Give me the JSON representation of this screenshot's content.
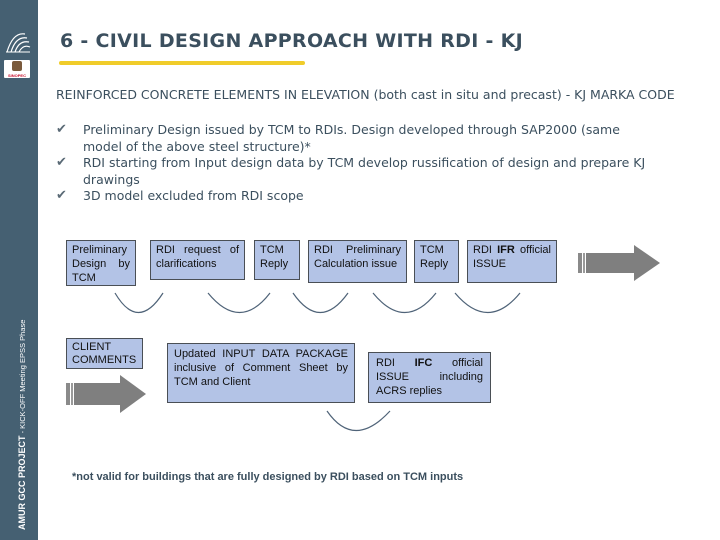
{
  "sidebar": {
    "logo_text": "SINOPEC",
    "vertical_label_main": "AMUR GCC PROJECT",
    "vertical_label_sub": " - KICK-OFF Meeting  EPSS Phase"
  },
  "slide": {
    "title": "6 - CIVIL DESIGN APPROACH WITH RDI - KJ",
    "intro": "REINFORCED CONCRETE ELEMENTS IN ELEVATION (both cast in situ and precast) - KJ MARKA CODE",
    "bullets": [
      {
        "icon": "check-icon",
        "text": "Preliminary Design issued by TCM to RDIs. Design developed through SAP2000 (same model of the above steel structure)*"
      },
      {
        "icon": "check-icon",
        "text": "RDI starting from Input design data by TCM develop russification of design and prepare KJ drawings"
      },
      {
        "icon": "check-icon",
        "text": "3D model excluded from RDI scope"
      }
    ]
  },
  "flow_row1": [
    {
      "text": "Preliminary Design by TCM"
    },
    {
      "text": "RDI request of clarifications"
    },
    {
      "text": "TCM Reply"
    },
    {
      "text": "RDI Preliminary Calculation issue"
    },
    {
      "text": "TCM Reply"
    },
    {
      "pre": "RDI ",
      "bold": "IFR",
      "post": " official ISSUE"
    }
  ],
  "flow_row2": [
    {
      "text": "CLIENT COMMENTS"
    },
    {
      "text": "Updated INPUT DATA PACKAGE inclusive of Comment Sheet by TCM and Client"
    },
    {
      "pre": "RDI ",
      "bold": "IFC",
      "post": " official ISSUE including ACRS replies"
    }
  ],
  "footnote": "*not valid for buildings that are fully designed by RDI based on TCM inputs",
  "colors": {
    "sidebar": "#456072",
    "title": "#3b4f5e",
    "underline": "#f0cc2a",
    "box_fill": "#b3c3e6",
    "arrow": "#7f7f7f"
  }
}
